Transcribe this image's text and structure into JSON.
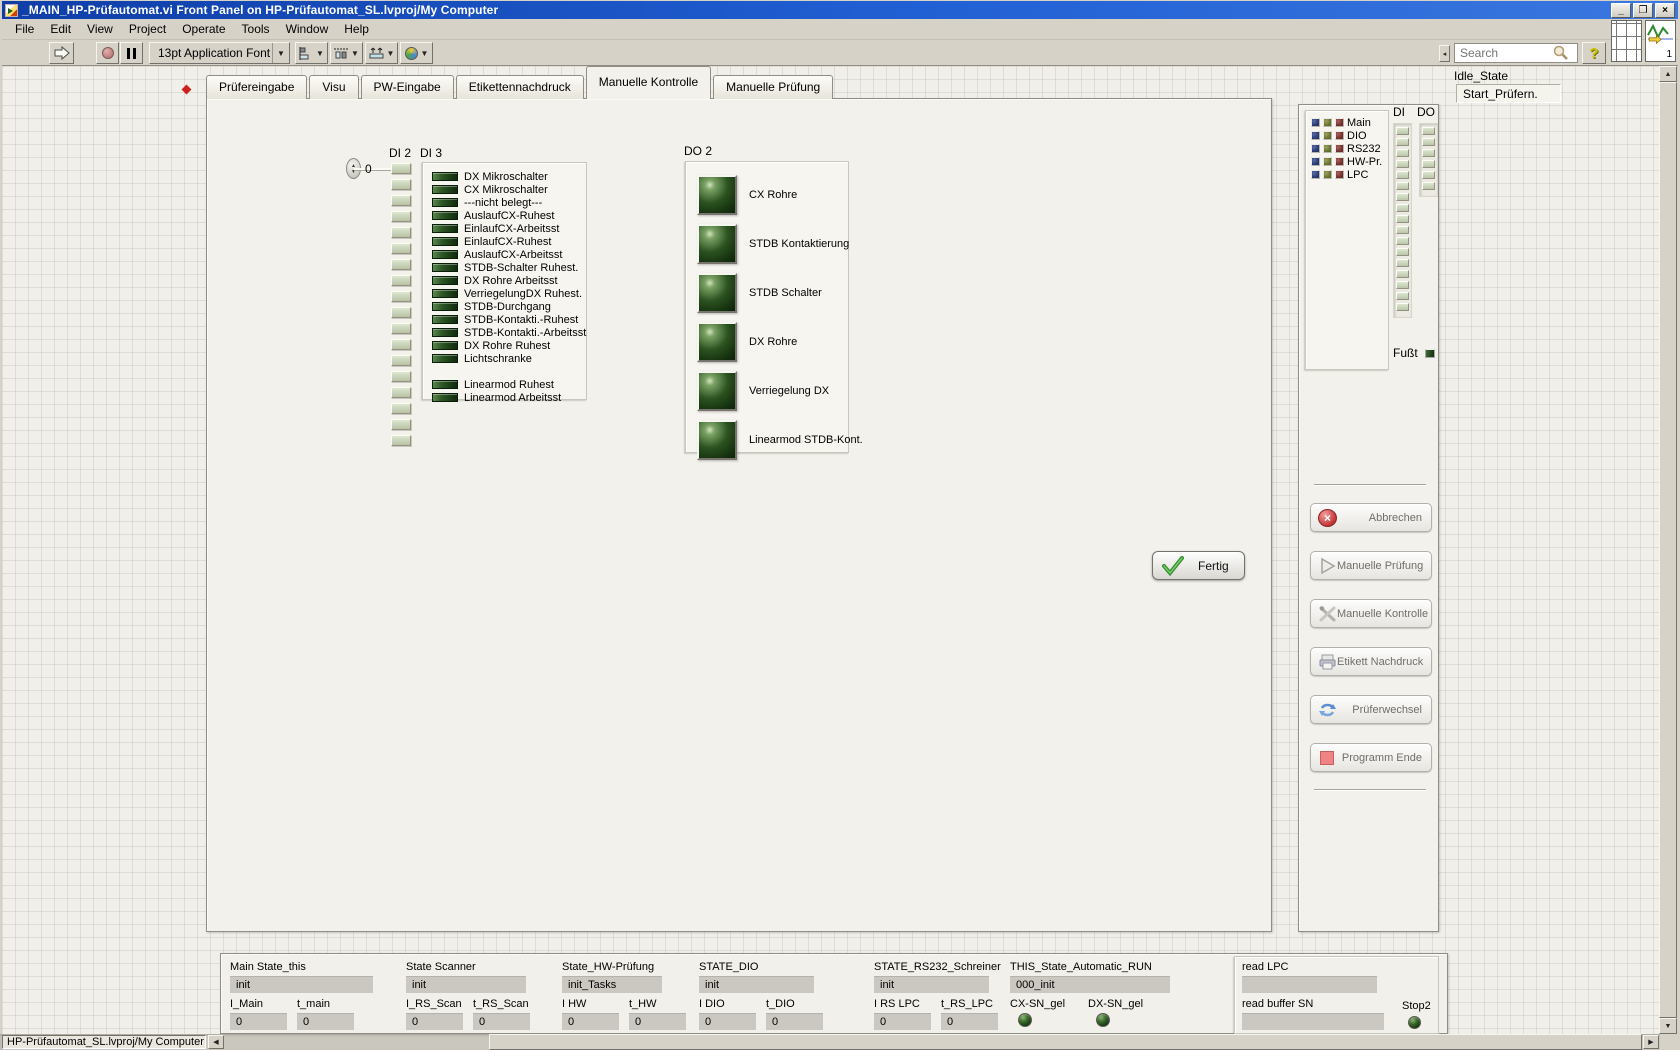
{
  "window": {
    "title": "_MAIN_HP-Prüfautomat.vi Front Panel on HP-Prüfautomat_SL.lvproj/My Computer",
    "statusbar_context": "HP-Prüfautomat_SL.lvproj/My Computer"
  },
  "menu": {
    "items": [
      "File",
      "Edit",
      "View",
      "Project",
      "Operate",
      "Tools",
      "Window",
      "Help"
    ]
  },
  "toolbar": {
    "font_selector": "13pt Application Font",
    "search_placeholder": "Search",
    "help_label": "?",
    "vi_icon_number": "1"
  },
  "tabs": {
    "active_index": 4,
    "items": [
      "Prüfereingabe",
      "Visu",
      "PW-Eingabe",
      "Etikettennachdruck",
      "Manuelle Kontrolle",
      "Manuelle Prüfung"
    ]
  },
  "manual_control": {
    "index_value": "0",
    "di2_label": "DI 2",
    "di2_led_count": 18,
    "di3_label": "DI 3",
    "di3_items": [
      "DX Mikroschalter",
      "CX Mikroschalter",
      "---nicht belegt---",
      "AuslaufCX-Ruhest",
      "EinlaufCX-Arbeitsst",
      "EinlaufCX-Ruhest",
      "AuslaufCX-Arbeitsst",
      "STDB-Schalter Ruhest.",
      "DX Rohre Arbeitsst",
      "VerriegelungDX Ruhest.",
      "STDB-Durchgang",
      "STDB-Kontakti.-Ruhest",
      "STDB-Kontakti.-Arbeitsst",
      "DX Rohre Ruhest",
      "Lichtschranke"
    ],
    "di3_items_group2": [
      "Linearmod Ruhest",
      "Linearmod Arbeitsst"
    ],
    "do2_label": "DO 2",
    "do2_items": [
      "CX Rohre",
      "STDB Kontaktierung",
      "STDB Schalter",
      "DX Rohre",
      "Verriegelung DX",
      "Linearmod STDB-Kont."
    ],
    "fertig_label": "Fertig"
  },
  "status_panel": {
    "process_list": [
      "Main",
      "DIO",
      "RS232",
      "HW-Pr.",
      "LPC"
    ],
    "di_label": "DI",
    "di_led_count": 17,
    "do_label": "DO",
    "do_led_count": 6,
    "fusst_label": "Fußt",
    "buttons": [
      {
        "label": "Abbrechen",
        "icon": "cancel-icon"
      },
      {
        "label": "Manuelle Prüfung",
        "icon": "play-icon"
      },
      {
        "label": "Manuelle Kontrolle",
        "icon": "tools-icon"
      },
      {
        "label": "Etikett Nachdruck",
        "icon": "printer-icon"
      },
      {
        "label": "Prüferwechsel",
        "icon": "refresh-icon"
      },
      {
        "label": "Programm Ende",
        "icon": "stop-icon"
      }
    ]
  },
  "state_display": {
    "label": "Idle_State",
    "value": "Start_Prüfern."
  },
  "bottom_panel": {
    "clusters": [
      {
        "title": "Main State_this",
        "state": "init",
        "fields": [
          {
            "label": "I_Main",
            "value": "0"
          },
          {
            "label": "t_main",
            "value": "0"
          }
        ]
      },
      {
        "title": "State Scanner",
        "state": "init",
        "fields": [
          {
            "label": "I_RS_Scan",
            "value": "0"
          },
          {
            "label": "t_RS_Scan",
            "value": "0"
          }
        ]
      },
      {
        "title": "State_HW-Prüfung",
        "state": "init_Tasks",
        "fields": [
          {
            "label": "I HW",
            "value": "0"
          },
          {
            "label": "t_HW",
            "value": "0"
          }
        ]
      },
      {
        "title": "STATE_DIO",
        "state": "init",
        "fields": [
          {
            "label": "I DIO",
            "value": "0"
          },
          {
            "label": "t_DIO",
            "value": "0"
          }
        ]
      },
      {
        "title": "STATE_RS232_Schreiner",
        "state": "init",
        "fields": [
          {
            "label": "I RS LPC",
            "value": "0"
          },
          {
            "label": "t_RS_LPC",
            "value": "0"
          }
        ]
      }
    ],
    "automatic_cluster": {
      "title": "THIS_State_Automatic_RUN",
      "state": "000_init",
      "leds": [
        {
          "label": "CX-SN_gel"
        },
        {
          "label": "DX-SN_gel"
        }
      ]
    },
    "read_cluster": {
      "read_lpc_label": "read LPC",
      "read_lpc_value": "",
      "read_buffer_label": "read buffer SN",
      "read_buffer_value": "",
      "stop_label": "Stop2"
    }
  },
  "colors": {
    "titlebar_blue": "#2160d4",
    "led_dark_green": "#1c3c14",
    "led_pale_green": "#c9d3b9",
    "list_square_blue": "#25356e",
    "list_square_green": "#636d2c",
    "list_square_red": "#702a2a",
    "abort_red": "#c25858",
    "program_end_pink": "#f08484",
    "check_green": "#3aa03a"
  }
}
